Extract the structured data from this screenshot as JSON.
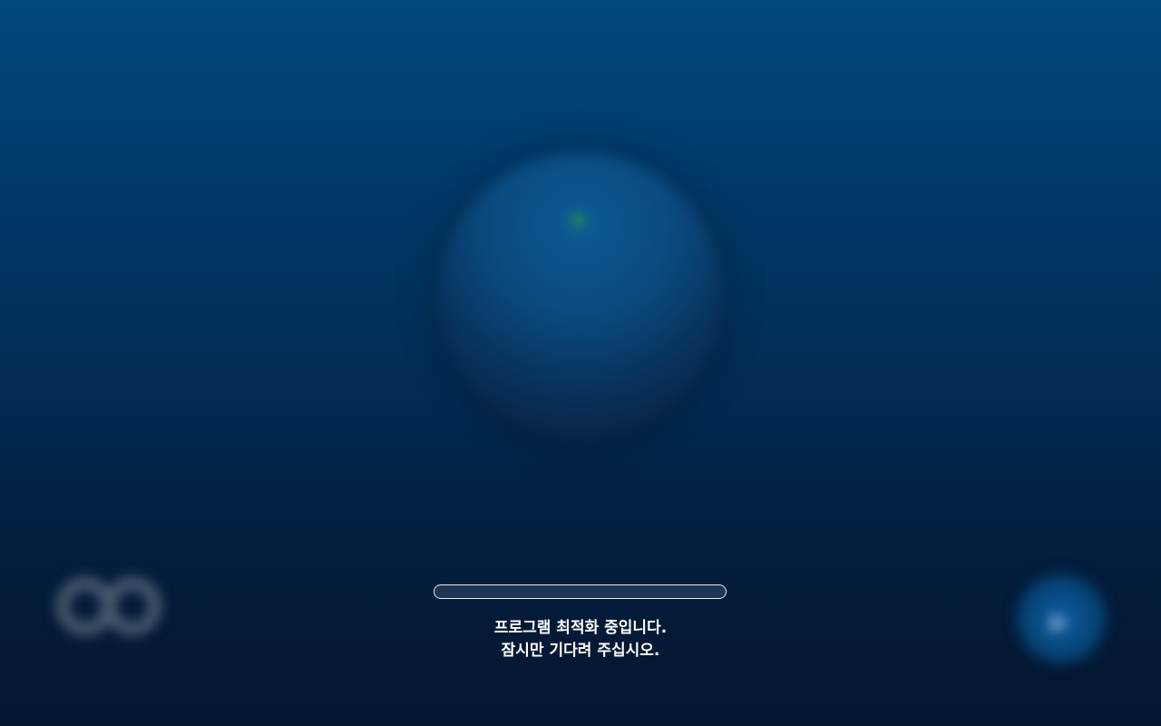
{
  "window": {
    "background": "#022a52",
    "accent": "#ffffff"
  },
  "backdrop": {
    "center_badge": {
      "line1": "",
      "line2": "",
      "dot_color": "#2f9a4c"
    },
    "status_text": "",
    "brand": {
      "icon": "brand-rings-logo",
      "text": ""
    },
    "corner_button": {
      "icon": "play-icon",
      "label": ""
    }
  },
  "loading": {
    "progress": 0,
    "message_line1": "프로그램 최적화 중입니다.",
    "message_line2": "잠시만 기다려 주십시오."
  }
}
